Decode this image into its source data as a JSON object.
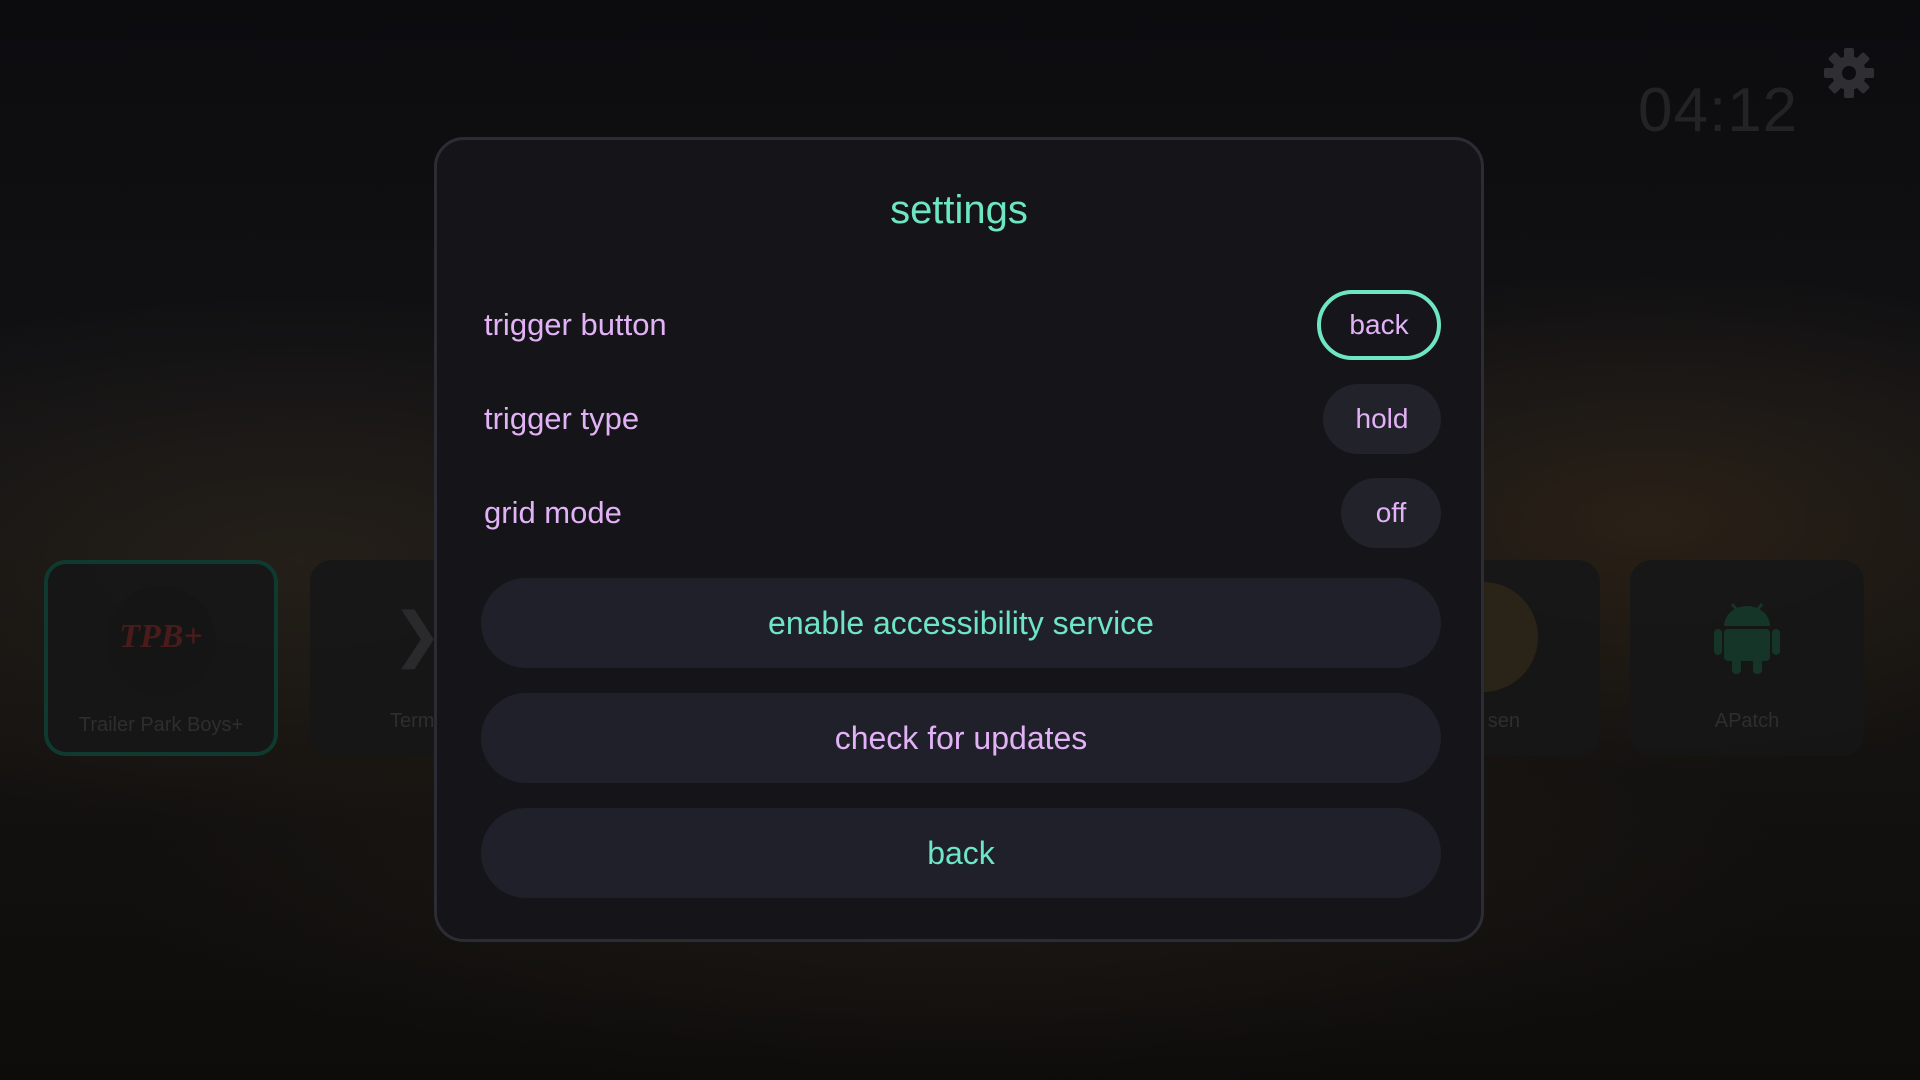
{
  "background": {
    "clock": "04:12",
    "tiles": [
      {
        "label": "Trailer Park Boys+",
        "logo": "TPB+"
      },
      {
        "label": "Term"
      },
      {
        "label": "sen"
      },
      {
        "label": "APatch"
      }
    ]
  },
  "dialog": {
    "title": "settings",
    "rows": [
      {
        "label": "trigger button",
        "value": "back",
        "focused": true
      },
      {
        "label": "trigger type",
        "value": "hold"
      },
      {
        "label": "grid mode",
        "value": "off"
      }
    ],
    "buttons": {
      "accessibility": "enable accessibility service",
      "updates": "check for updates",
      "back": "back"
    }
  },
  "colors": {
    "accent": "#6ee6c4",
    "text": "#e2b2f6",
    "dialog_bg": "#141419"
  },
  "icons": [
    "gear-icon",
    "chevron-right-icon",
    "android-icon"
  ]
}
